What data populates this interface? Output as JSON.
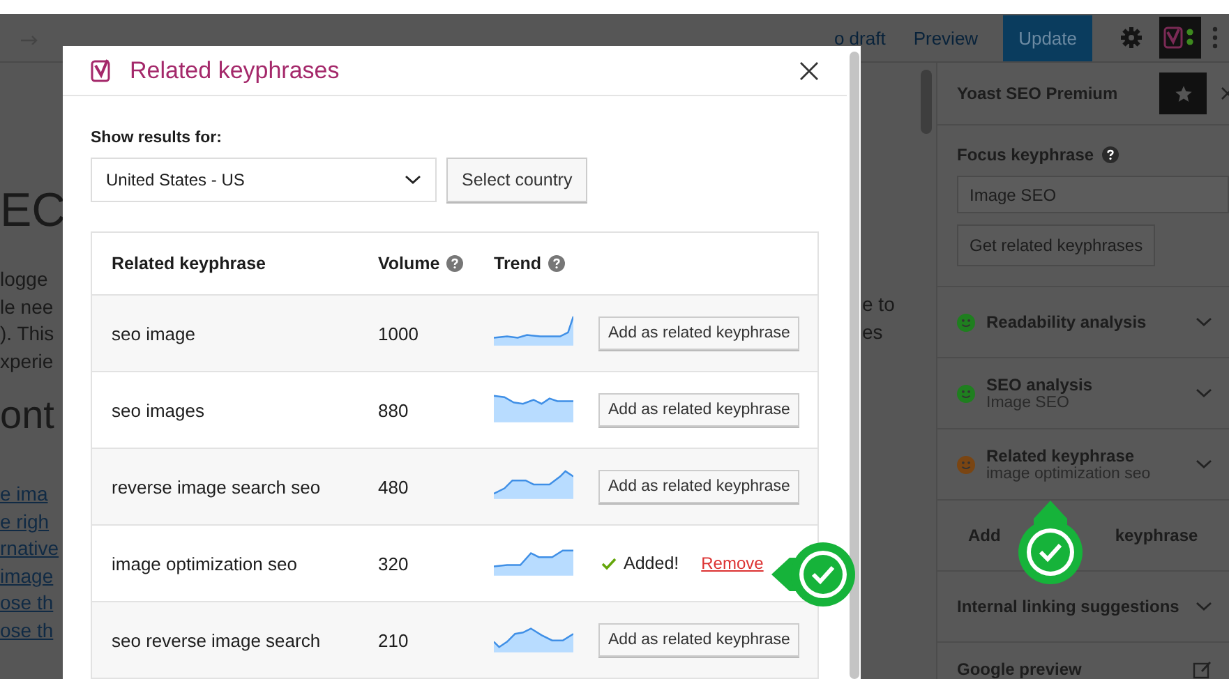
{
  "toolbar": {
    "draft_link": "o draft",
    "preview": "Preview",
    "update": "Update"
  },
  "editor": {
    "title": "EC",
    "paragraph": [
      "logge",
      "le nee",
      "). This",
      "xperie"
    ],
    "heading": "ont",
    "links": [
      "e ima",
      "e righ",
      "rnative",
      "image",
      "ose th",
      "ose th"
    ],
    "right_lines": [
      "e to",
      "es"
    ]
  },
  "modal": {
    "title": "Related keyphrases",
    "filter_label": "Show results for:",
    "country": "United States - US",
    "select_button": "Select country",
    "columns": [
      {
        "label": "Related keyphrase",
        "help": false
      },
      {
        "label": "Volume",
        "help": true
      },
      {
        "label": "Trend",
        "help": true
      }
    ],
    "rows": [
      {
        "keyphrase": "seo image",
        "volume": "1000",
        "added": false,
        "button": "Add as related keyphrase"
      },
      {
        "keyphrase": "seo images",
        "volume": "880",
        "added": false,
        "button": "Add as related keyphrase"
      },
      {
        "keyphrase": "reverse image search seo",
        "volume": "480",
        "added": false,
        "button": "Add as related keyphrase"
      },
      {
        "keyphrase": "image optimization seo",
        "volume": "320",
        "added": true,
        "added_label": "Added!",
        "remove_link": "Remove"
      },
      {
        "keyphrase": "seo reverse image search",
        "volume": "210",
        "added": false,
        "button": "Add as related keyphrase"
      }
    ]
  },
  "sidebar": {
    "title": "Yoast SEO Premium",
    "focus_label": "Focus keyphrase",
    "focus_value": "Image SEO",
    "get_related_button": "Get related keyphrases",
    "sections": [
      {
        "kind": "analysis",
        "title": "Readability analysis",
        "color": "#1f7f1f"
      },
      {
        "kind": "analysis",
        "title": "SEO analysis",
        "subtitle": "Image SEO",
        "color": "#1f7f1f"
      },
      {
        "kind": "analysis",
        "title": "Related keyphrase",
        "subtitle": "image optimization seo",
        "color": "#7a4512"
      },
      {
        "kind": "add",
        "title_parts": [
          "Add",
          "keyphrase"
        ]
      },
      {
        "kind": "plain",
        "title": "Internal linking suggestions"
      },
      {
        "kind": "edit",
        "title": "Google preview"
      }
    ]
  }
}
